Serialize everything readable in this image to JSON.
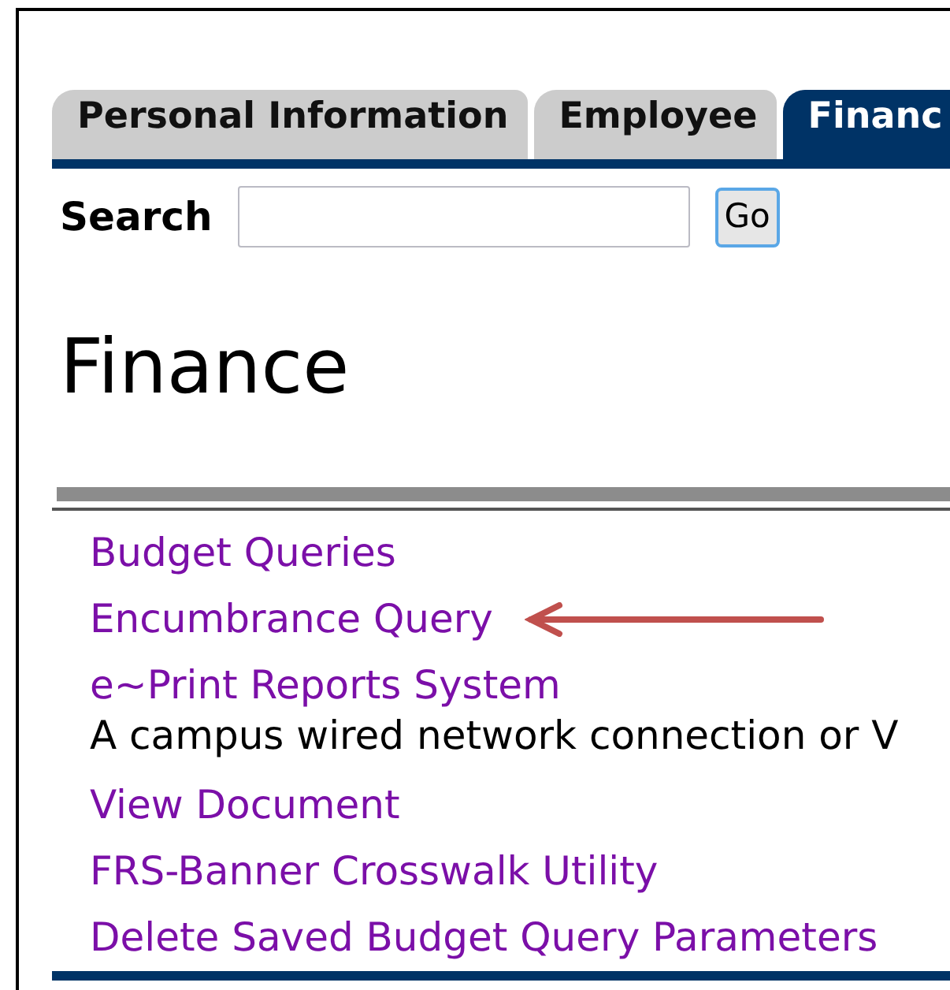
{
  "tabs": [
    {
      "label": "Personal Information",
      "selected": false
    },
    {
      "label": "Employee",
      "selected": false
    },
    {
      "label": "Financ",
      "selected": true
    }
  ],
  "search": {
    "label": "Search",
    "button": "Go"
  },
  "heading": "Finance",
  "items": [
    {
      "kind": "link",
      "text": "Budget Queries",
      "highlighted": false
    },
    {
      "kind": "link",
      "text": "Encumbrance Query",
      "highlighted": true
    },
    {
      "kind": "link",
      "text": "e~Print Reports System",
      "highlighted": false
    },
    {
      "kind": "text",
      "text": "A campus wired network connection or V",
      "highlighted": false
    },
    {
      "kind": "link",
      "text": "View Document",
      "highlighted": false
    },
    {
      "kind": "link",
      "text": "FRS-Banner Crosswalk Utility",
      "highlighted": false
    },
    {
      "kind": "link",
      "text": "Delete Saved Budget Query Parameters",
      "highlighted": false
    }
  ]
}
